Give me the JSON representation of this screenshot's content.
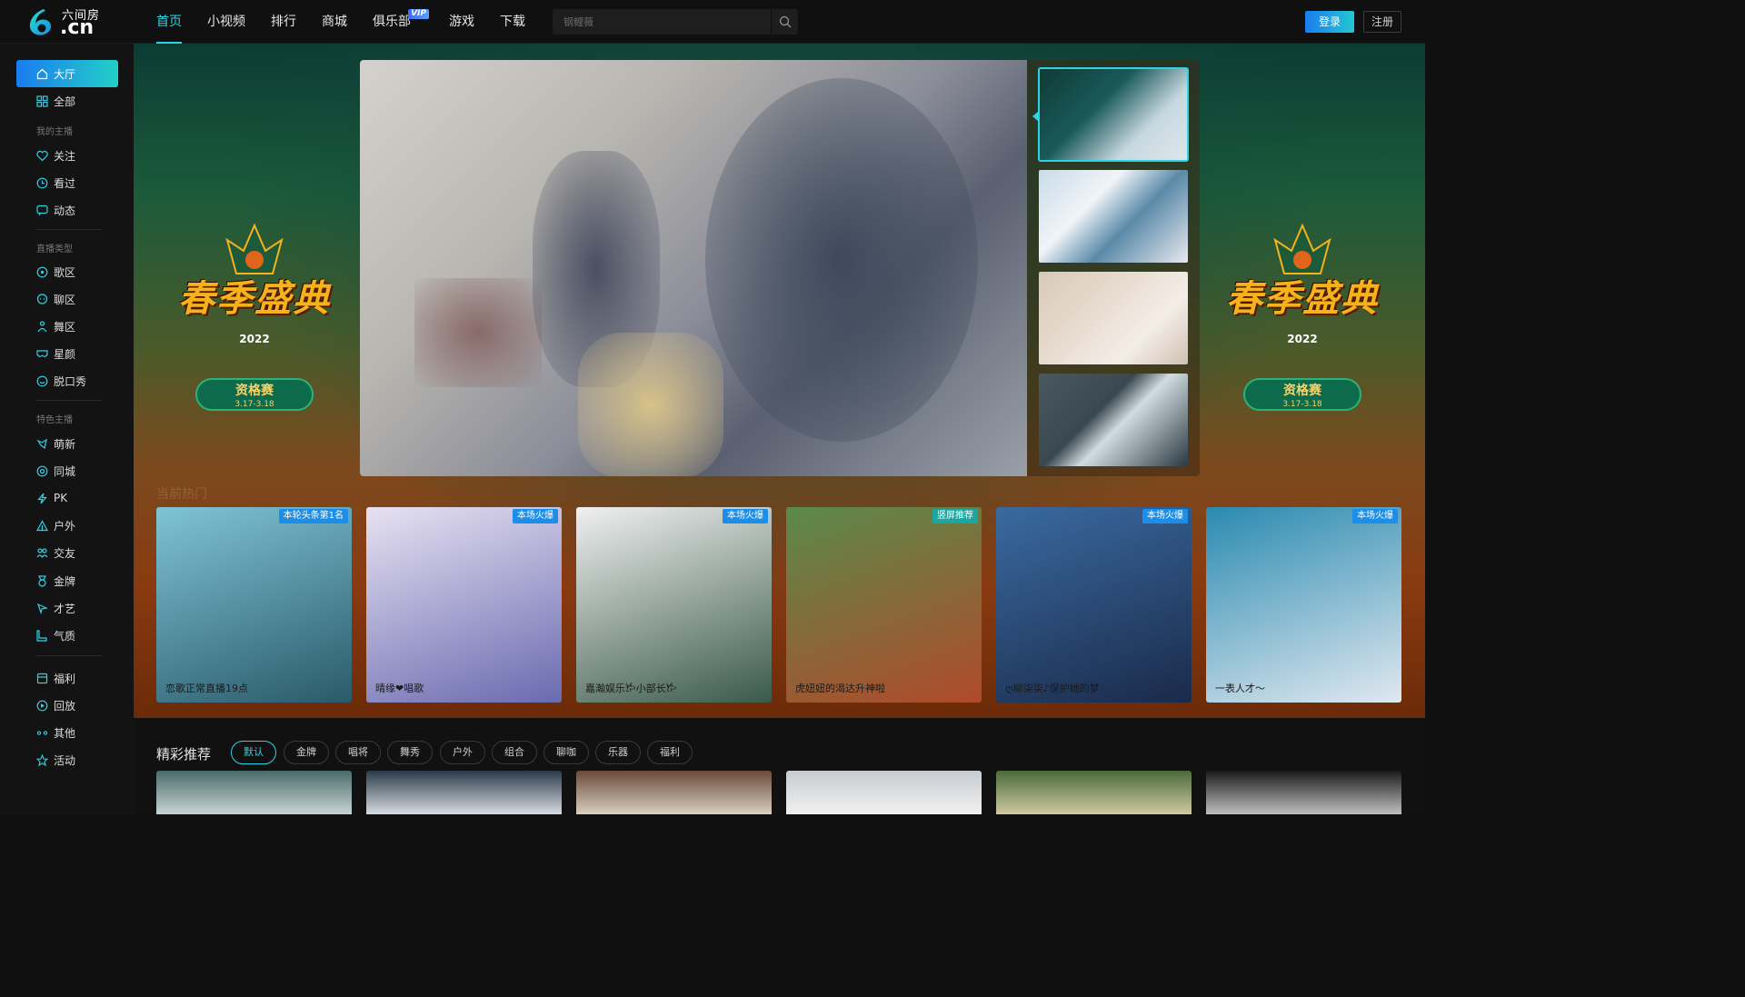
{
  "header": {
    "logo_sub": "六间房",
    "logo_main": ".cn",
    "nav": [
      {
        "label": "首页",
        "active": true
      },
      {
        "label": "小视频"
      },
      {
        "label": "排行"
      },
      {
        "label": "商城"
      },
      {
        "label": "俱乐部",
        "badge": "VIP"
      },
      {
        "label": "游戏"
      },
      {
        "label": "下载"
      }
    ],
    "search_placeholder": "钢鲤薇",
    "login": "登录",
    "register": "注册"
  },
  "sidebar": {
    "top": [
      {
        "label": "大厅",
        "icon": "home-icon",
        "active": true
      },
      {
        "label": "全部",
        "icon": "grid-icon"
      }
    ],
    "group1_title": "我的主播",
    "group1": [
      {
        "label": "关注",
        "icon": "heart-icon"
      },
      {
        "label": "看过",
        "icon": "clock-icon"
      },
      {
        "label": "动态",
        "icon": "chat-icon"
      }
    ],
    "group2_title": "直播类型",
    "group2": [
      {
        "label": "歌区",
        "icon": "music-icon"
      },
      {
        "label": "聊区",
        "icon": "bubble-icon"
      },
      {
        "label": "舞区",
        "icon": "dance-icon"
      },
      {
        "label": "星颜",
        "icon": "mask-icon"
      },
      {
        "label": "脱口秀",
        "icon": "mic-icon"
      }
    ],
    "group3_title": "特色主播",
    "group3": [
      {
        "label": "萌新",
        "icon": "sprout-icon"
      },
      {
        "label": "同城",
        "icon": "location-icon"
      },
      {
        "label": "PK",
        "icon": "bolt-icon"
      },
      {
        "label": "户外",
        "icon": "tent-icon"
      },
      {
        "label": "交友",
        "icon": "people-icon"
      },
      {
        "label": "金牌",
        "icon": "medal-icon"
      },
      {
        "label": "才艺",
        "icon": "palette-icon"
      },
      {
        "label": "气质",
        "icon": "boot-icon"
      }
    ],
    "group4": [
      {
        "label": "福利",
        "icon": "gift-icon"
      },
      {
        "label": "回放",
        "icon": "replay-icon"
      },
      {
        "label": "其他",
        "icon": "more-icon"
      },
      {
        "label": "活动",
        "icon": "star-icon"
      }
    ]
  },
  "banner": {
    "festival_text": "春季盛典",
    "festival_year": "2022",
    "pill_main": "资格赛",
    "pill_date": "3.17-3.18"
  },
  "hot_section_title": "当前热门",
  "hot_cards": [
    {
      "tag": "本轮头条第1名",
      "title": "恋歌正常直播19点",
      "colors": [
        "#7fc4d6",
        "#2a5a6a"
      ]
    },
    {
      "tag": "本场火爆",
      "title": "晴缘❤唱歌",
      "colors": [
        "#e7e2f2",
        "#6a6ab0"
      ]
    },
    {
      "tag": "本场火爆",
      "title": "嘉瀚娱乐𐂂小部长𐂂",
      "colors": [
        "#f0f0f0",
        "#3a5a4a"
      ]
    },
    {
      "tag": "竖屏推荐",
      "title": "虎妞妞的渴达升神啦",
      "colors": [
        "#5a8a4a",
        "#b04a2a"
      ],
      "green": true
    },
    {
      "tag": "本场火爆",
      "title": "ღ柳柒柒♪保护她的梦",
      "colors": [
        "#3a6aa0",
        "#1a2a4a"
      ]
    },
    {
      "tag": "本场火爆",
      "title": "一表人才～",
      "colors": [
        "#2a8ab0",
        "#e0e8f0"
      ]
    }
  ],
  "recommend": {
    "title": "精彩推荐",
    "chips": [
      {
        "label": "默认",
        "active": true
      },
      {
        "label": "金牌"
      },
      {
        "label": "唱将"
      },
      {
        "label": "舞秀"
      },
      {
        "label": "户外"
      },
      {
        "label": "组合"
      },
      {
        "label": "聊咖"
      },
      {
        "label": "乐器"
      },
      {
        "label": "福利"
      }
    ],
    "cards": [
      {
        "colors": [
          "#4a6a6a",
          "#c8d4d4"
        ]
      },
      {
        "colors": [
          "#2a3a4a",
          "#d8dce0"
        ]
      },
      {
        "colors": [
          "#6a4a3a",
          "#d8d0c0"
        ]
      },
      {
        "colors": [
          "#c8ccd0",
          "#f0f0f0"
        ]
      },
      {
        "colors": [
          "#4a6a3a",
          "#d0c8a0"
        ]
      },
      {
        "colors": [
          "#1a1a1a",
          "#c0c0c0"
        ]
      }
    ]
  },
  "accent_color": "#2fd3e6"
}
